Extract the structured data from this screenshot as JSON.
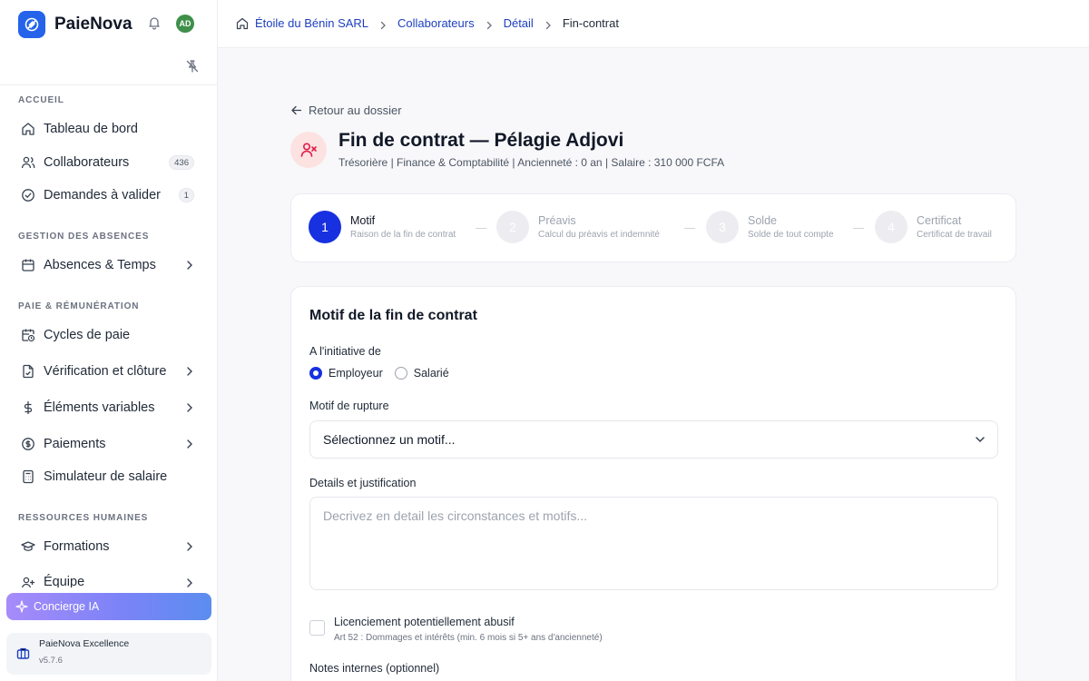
{
  "app": {
    "name": "PaieNova",
    "avatar_initials": "AD",
    "accent": "#1730e0",
    "danger": "#e11d48"
  },
  "sidebar": {
    "sections": {
      "accueil": "ACCUEIL",
      "absences": "GESTION DES ABSENCES",
      "paie": "PAIE & RÉMUNÉRATION",
      "rh": "RESSOURCES HUMAINES"
    },
    "items": {
      "tableau": {
        "label": "Tableau de bord",
        "icon": "home-icon"
      },
      "collaborateurs": {
        "label": "Collaborateurs",
        "icon": "users-icon",
        "count": "436"
      },
      "demandes": {
        "label": "Demandes à valider",
        "icon": "check-circle-icon",
        "count": "1"
      },
      "absences": {
        "label": "Absences & Temps",
        "icon": "calendar-icon"
      },
      "cycles": {
        "label": "Cycles de paie",
        "icon": "calendar-clock-icon"
      },
      "verification": {
        "label": "Vérification et clôture",
        "icon": "file-check-icon"
      },
      "elements": {
        "label": "Éléments variables",
        "icon": "dollar-icon"
      },
      "paiements": {
        "label": "Paiements",
        "icon": "coin-icon"
      },
      "simulateur": {
        "label": "Simulateur de salaire",
        "icon": "calculator-icon"
      },
      "formations": {
        "label": "Formations",
        "icon": "graduation-cap-icon"
      },
      "equipe": {
        "label": "Équipe",
        "icon": "user-plus-icon"
      }
    },
    "concierge": "Concierge IA",
    "plan": {
      "name": "PaieNova Excellence",
      "version": "v5.7.6"
    }
  },
  "breadcrumb": {
    "items": [
      "Étoile du Bénin SARL",
      "Collaborateurs",
      "Détail"
    ],
    "current": "Fin-contrat"
  },
  "page": {
    "back": "Retour au dossier",
    "title": "Fin de contrat — Pélagie Adjovi",
    "subtitle": "Trésorière | Finance & Comptabilité | Ancienneté : 0 an | Salaire : 310 000 FCFA"
  },
  "steps": [
    {
      "num": "1",
      "title": "Motif",
      "desc": "Raison de la fin de contrat"
    },
    {
      "num": "2",
      "title": "Préavis",
      "desc": "Calcul du préavis et indemnité"
    },
    {
      "num": "3",
      "title": "Solde",
      "desc": "Solde de tout compte"
    },
    {
      "num": "4",
      "title": "Certificat",
      "desc": "Certificat de travail"
    }
  ],
  "form": {
    "title": "Motif de la fin de contrat",
    "initiative_label": "A l'initiative de",
    "options": [
      "Employeur",
      "Salarié"
    ],
    "selected_option": "Employeur",
    "motif_label": "Motif de rupture",
    "motif_value": "Sélectionnez un motif...",
    "details_label": "Details et justification",
    "details_placeholder": "Decrivez en detail les circonstances et motifs...",
    "abusif_label": "Licenciement potentiellement abusif",
    "abusif_note": "Art 52 : Dommages et intérêts (min. 6 mois si 5+ ans d'ancienneté)",
    "notes_label": "Notes internes (optionnel)"
  }
}
